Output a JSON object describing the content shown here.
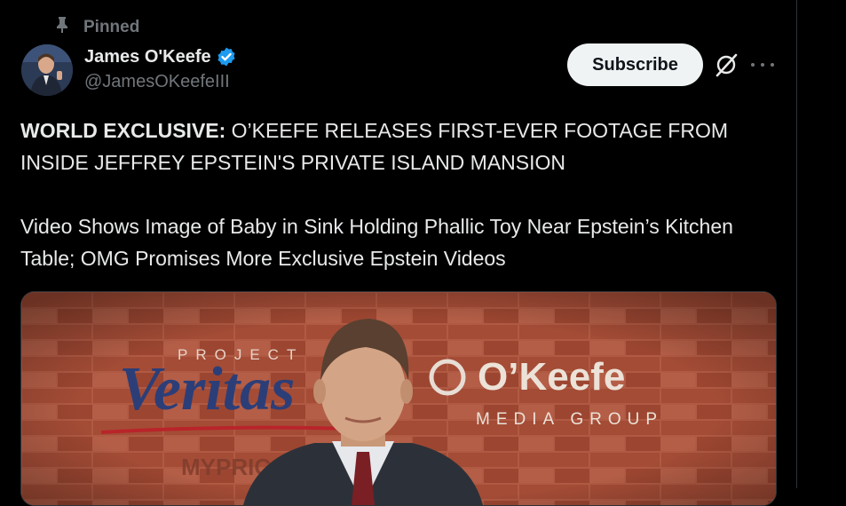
{
  "pinned_label": "Pinned",
  "author": {
    "name": "James O'Keefe",
    "handle": "@JamesOKeefeIII"
  },
  "subscribe_label": "Subscribe",
  "post": {
    "headline_bold": "WORLD EXCLUSIVE:",
    "headline_rest": " O’KEEFE RELEASES FIRST-EVER FOOTAGE FROM INSIDE JEFFREY EPSTEIN'S PRIVATE ISLAND MANSION",
    "body": "Video Shows Image of Baby in Sink Holding Phallic Toy Near Epstein’s Kitchen Table; OMG Promises More Exclusive Epstein Videos"
  },
  "media": {
    "logo_left_small": "PROJECT",
    "logo_left_big": "Veritas",
    "logo_right_big": "O’Keefe",
    "logo_right_small": "MEDIA GROUP",
    "bottom_text": "MYPRIC              .COM"
  },
  "colors": {
    "background": "#000000",
    "verified": "#1d9bf0",
    "secondary_text": "#71767b",
    "brick": "#a4503a"
  }
}
